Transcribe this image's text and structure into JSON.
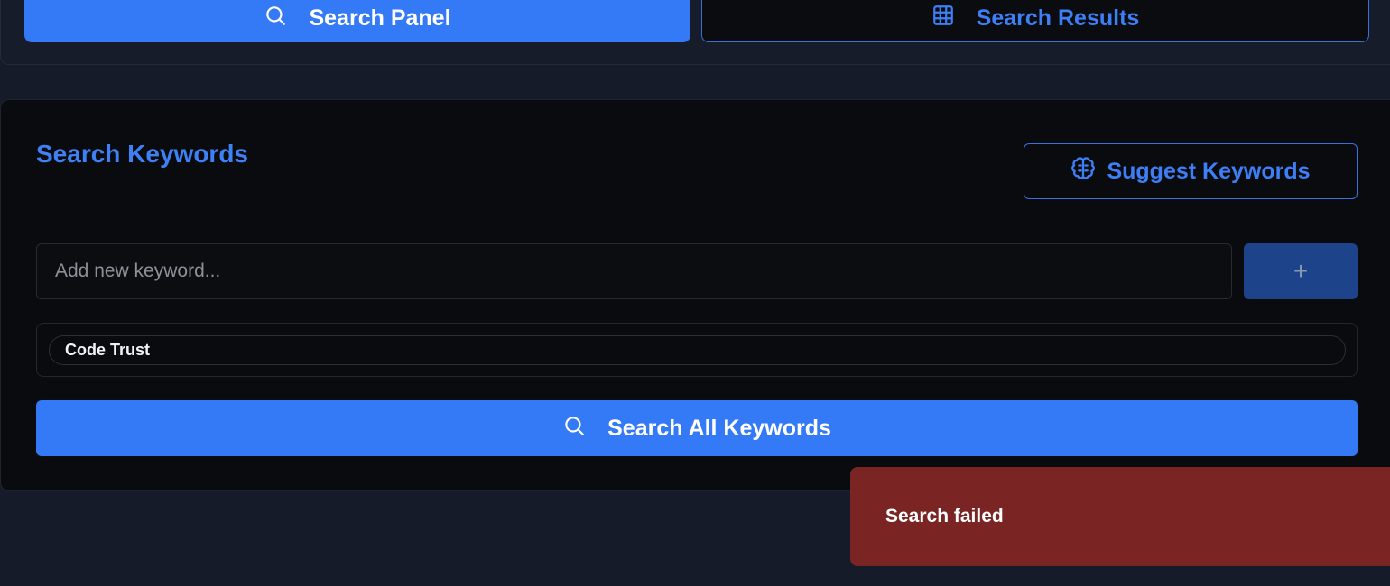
{
  "tabs": {
    "search_panel": "Search Panel",
    "search_results": "Search Results"
  },
  "keywords": {
    "title": "Search Keywords",
    "suggest_label": "Suggest Keywords",
    "input_placeholder": "Add new keyword...",
    "input_value": "",
    "add_label": "+",
    "items": [
      {
        "label": "Code Trust"
      }
    ],
    "search_all_label": "Search All Keywords"
  },
  "toast": {
    "message": "Search failed"
  },
  "colors": {
    "accent": "#3479f5",
    "background": "#151b29",
    "card": "#0a0b0e",
    "error": "#7a2424"
  },
  "icons": {
    "search_panel": "search-icon",
    "search_results": "grid-icon",
    "suggest": "brain-icon",
    "search_all": "search-icon"
  }
}
